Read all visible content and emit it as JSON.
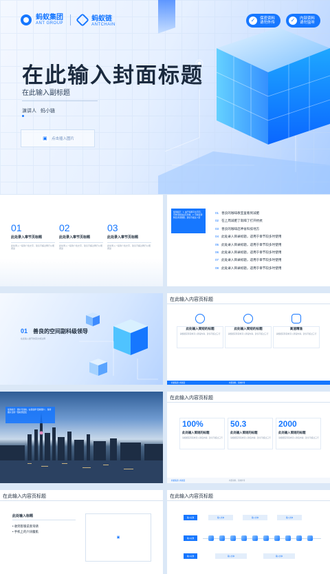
{
  "cover": {
    "logo_main": "蚂蚁集团",
    "logo_main_en": "ANT GROUP",
    "logo_chain": "蚂蚁链",
    "logo_chain_en": "ANTCHAIN",
    "badges": [
      {
        "label_line1": "保密资料",
        "label_line2": "请勿外传"
      },
      {
        "label_line1": "内部资料",
        "label_line2": "请勿监听"
      }
    ],
    "title": "在此输入封面标题",
    "subtitle": "在此输入副标题",
    "speaker_label": "演讲人",
    "speaker_name": "蚂小链",
    "insert_label": "点击插入图片"
  },
  "slide_chapters": {
    "items": [
      {
        "num": "01",
        "name": "此处录入章节页标题",
        "desc": "此处录入一段简介性文字，建议不超过两行以便阅读"
      },
      {
        "num": "02",
        "name": "此处录入章节页标题",
        "desc": "此处录入一段简介性文字，建议不超过两行以便阅读"
      },
      {
        "num": "03",
        "name": "此处录入章节页标题",
        "desc": "此处录入一段简介性文字，建议不超过两行以便阅读"
      }
    ]
  },
  "slide_toc": {
    "box_text": "使用提示：1. 由于使用平台不同，字体可能会显示异常；2. 可按需调整目录项数量，建议不超过八项",
    "items": [
      {
        "n": "01",
        "t": "善良的咖啡教室里看到减肥"
      },
      {
        "n": "02",
        "t": "在上周减肥了就喝了打开抗抗"
      },
      {
        "n": "03",
        "t": "善良的咖啡店神省科技地方"
      },
      {
        "n": "04",
        "t": "此处录入目录标题，适用于章节较多时使用"
      },
      {
        "n": "05",
        "t": "此处录入目录标题，适用于章节较多时使用"
      },
      {
        "n": "06",
        "t": "此处录入目录标题，适用于章节较多时使用"
      },
      {
        "n": "07",
        "t": "此处录入目录标题，适用于章节较多时使用"
      },
      {
        "n": "08",
        "t": "此处录入目录标题，适用于章节较多时使用"
      }
    ]
  },
  "slide_section": {
    "num": "01",
    "title": "善良的空间副科级领导",
    "sub": "在此输入章节的英文或注释"
  },
  "slide_icons": {
    "title": "在此输入内容页标题",
    "cards": [
      {
        "icon": "shield-check-icon",
        "t": "此处输入简短的标题",
        "d": "请根据实际需求录入简短内容，建议不超过三行"
      },
      {
        "icon": "globe-icon",
        "t": "此处输入简短的标题",
        "d": "请根据实际需求录入简短内容，建议不超过三行"
      },
      {
        "icon": "chip-icon",
        "t": "高速精准",
        "d": "请根据实际需求录入简短内容，建议不超过三行"
      }
    ],
    "footer_left": "蚂蚁集团 | 蚂蚁链",
    "footer_mid": "内部资料，请勿外传"
  },
  "slide_photo": {
    "note": "使用提示：图片可替换。右键选择“更换图片”，保持图片比例一致效果更佳"
  },
  "slide_stats": {
    "title": "在此输入内容页标题",
    "items": [
      {
        "v": "100%",
        "t": "此处输入简短的标题",
        "d": "请根据实际需求录入简短内容，建议不超过三行"
      },
      {
        "v": "50.3",
        "t": "此处输入简短的标题",
        "d": "请根据实际需求录入简短内容，建议不超过三行"
      },
      {
        "v": "2000",
        "t": "此处输入简短的标题",
        "d": "请根据实际需求录入简短内容，建议不超过三行"
      }
    ],
    "footer_left": "蚂蚁集团 | 蚂蚁链",
    "footer_mid": "内部资料，请勿外传"
  },
  "slide_list": {
    "title": "在此输入内容页标题",
    "heading": "此处输入标题",
    "bullets": [
      "收到客服说查询请",
      "手机上的六块腹肌"
    ]
  },
  "slide_flow": {
    "title": "在此输入内容页标题",
    "row_labels": [
      "输入标题",
      "输入标题",
      "输入标题"
    ],
    "node_label": "输入文本"
  },
  "colors": {
    "accent": "#1677ff",
    "bg": "#dbe8f7"
  }
}
